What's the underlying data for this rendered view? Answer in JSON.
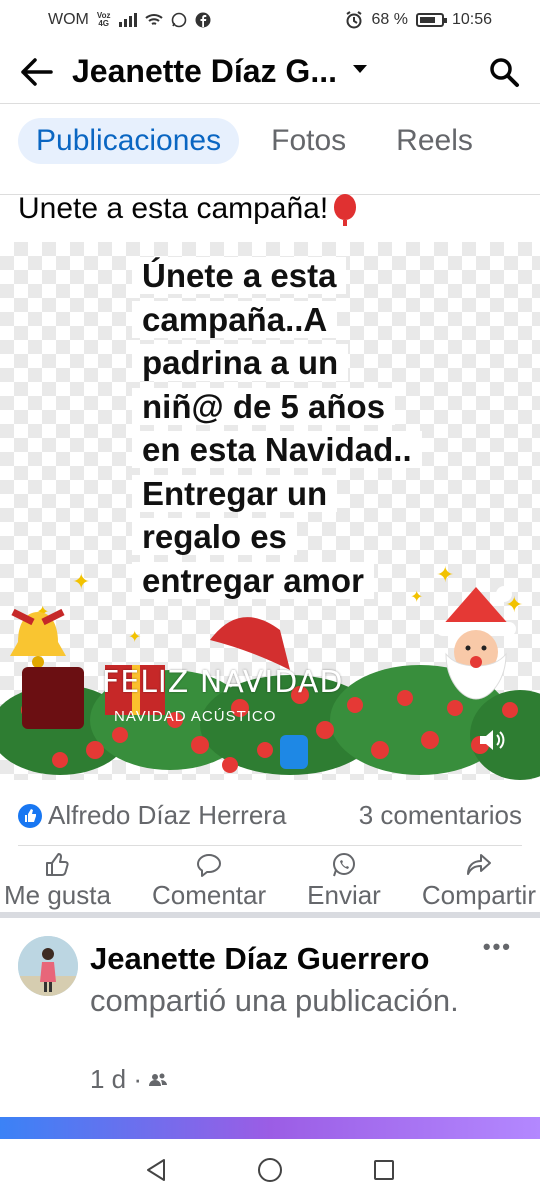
{
  "status": {
    "carrier": "WOM",
    "voz": "Voz",
    "net": "4G",
    "battery": "68 %",
    "time": "10:56"
  },
  "header": {
    "title": "Jeanette Díaz G..."
  },
  "tabs": [
    {
      "label": "Publicaciones"
    },
    {
      "label": "Fotos"
    },
    {
      "label": "Reels"
    }
  ],
  "post": {
    "text": "Unete a esta campaña!",
    "image_text": "Únete a esta campaña..A padrina a un niñ@ de 5 años en esta Navidad.. Entregar un regalo es entregar amor",
    "music_title": "FELIZ NAVIDAD",
    "music_artist": "NAVIDAD ACÚSTICO",
    "reactor": "Alfredo Díaz Herrera",
    "comments": "3 comentarios",
    "actions": [
      {
        "label": "Me gusta"
      },
      {
        "label": "Comentar"
      },
      {
        "label": "Enviar"
      },
      {
        "label": "Compartir"
      }
    ]
  },
  "post2": {
    "author": "Jeanette Díaz Guerrero",
    "action": "compartió una publicación.",
    "time": "1 d ·"
  }
}
